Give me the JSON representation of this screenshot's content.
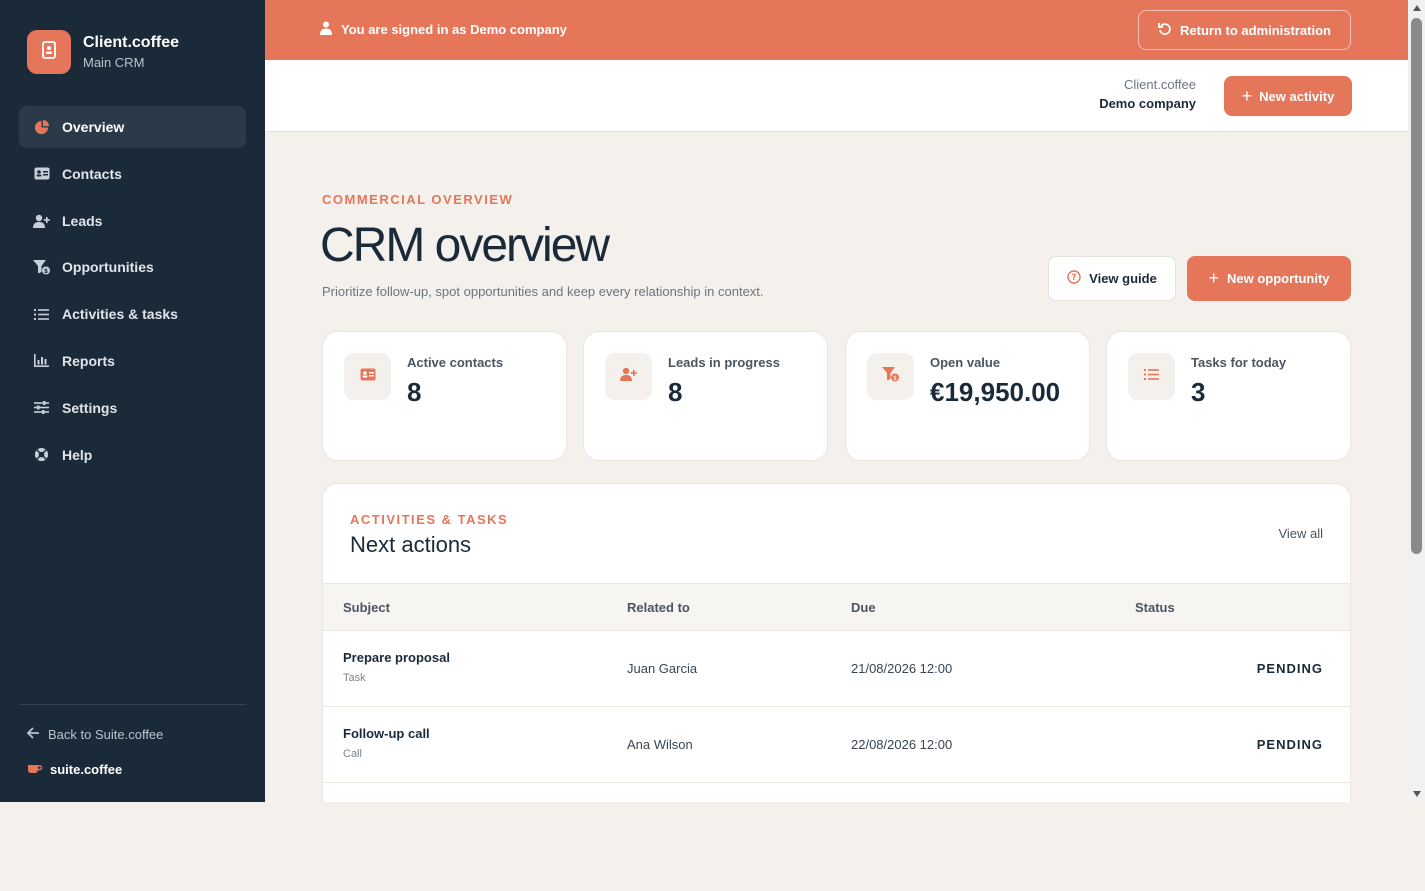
{
  "brand": {
    "name": "Client.coffee",
    "subtitle": "Main CRM"
  },
  "sidebar": {
    "items": [
      {
        "label": "Overview",
        "icon": "pie-chart-icon",
        "active": true
      },
      {
        "label": "Contacts",
        "icon": "address-card-icon"
      },
      {
        "label": "Leads",
        "icon": "user-plus-icon"
      },
      {
        "label": "Opportunities",
        "icon": "funnel-dollar-icon"
      },
      {
        "label": "Activities & tasks",
        "icon": "list-check-icon"
      },
      {
        "label": "Reports",
        "icon": "bar-chart-icon"
      },
      {
        "label": "Settings",
        "icon": "sliders-icon"
      },
      {
        "label": "Help",
        "icon": "lifebuoy-icon"
      }
    ],
    "back_link": "Back to Suite.coffee",
    "suite_name": "suite.coffee"
  },
  "banner": {
    "text": "You are signed in as Demo company",
    "return_label": "Return to administration"
  },
  "header": {
    "company_app": "Client.coffee",
    "company_name": "Demo company",
    "new_activity_label": "New activity"
  },
  "page": {
    "eyebrow": "COMMERCIAL OVERVIEW",
    "title": "CRM overview",
    "subtitle": "Prioritize follow-up, spot opportunities and keep every relationship in context.",
    "guide_label": "View guide",
    "new_opportunity_label": "New opportunity"
  },
  "stats": [
    {
      "label": "Active contacts",
      "value": "8",
      "icon": "address-card-icon"
    },
    {
      "label": "Leads in progress",
      "value": "8",
      "icon": "user-plus-icon"
    },
    {
      "label": "Open value",
      "value": "€19,950.00",
      "icon": "funnel-dollar-icon"
    },
    {
      "label": "Tasks for today",
      "value": "3",
      "icon": "list-check-icon"
    }
  ],
  "actions": {
    "eyebrow": "ACTIVITIES & TASKS",
    "title": "Next actions",
    "view_all": "View all",
    "columns": [
      "Subject",
      "Related to",
      "Due",
      "Status"
    ],
    "rows": [
      {
        "subject": "Prepare proposal",
        "type": "Task",
        "related": "Juan Garcia",
        "due": "21/08/2026 12:00",
        "status": "PENDING"
      },
      {
        "subject": "Follow-up call",
        "type": "Call",
        "related": "Ana Wilson",
        "due": "22/08/2026 12:00",
        "status": "PENDING"
      }
    ]
  },
  "colors": {
    "accent": "#e5765a",
    "sidebar": "#1b2a38",
    "background": "#f4f1ec"
  }
}
